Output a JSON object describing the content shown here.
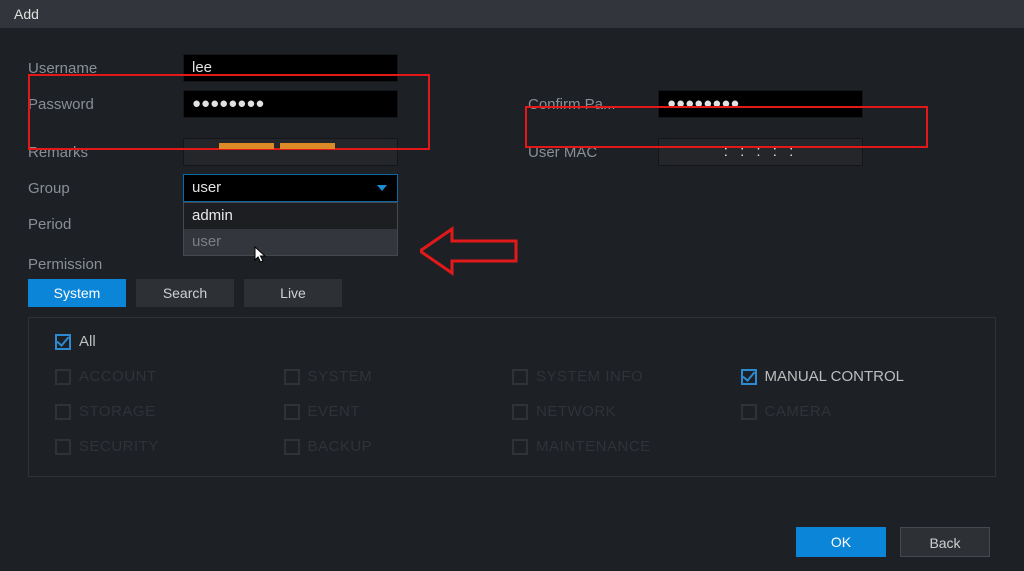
{
  "title": "Add",
  "form": {
    "username_label": "Username",
    "username_value": "lee",
    "password_label": "Password",
    "password_value": "●●●●●●●●",
    "confirm_label": "Confirm Pa...",
    "confirm_value": "●●●●●●●●",
    "remarks_label": "Remarks",
    "remarks_value": "",
    "usermac_label": "User MAC",
    "usermac_value": ":     :     :     :     :",
    "group_label": "Group",
    "group_selected": "user",
    "group_options": {
      "0": "admin",
      "1": "user"
    },
    "period_label": "Period",
    "permission_label": "Permission"
  },
  "tabs": {
    "system": "System",
    "search": "Search",
    "live": "Live"
  },
  "permissions": {
    "all": "All",
    "account": "ACCOUNT",
    "system": "SYSTEM",
    "systeminfo": "SYSTEM INFO",
    "manual": "MANUAL CONTROL",
    "storage": "STORAGE",
    "event": "EVENT",
    "network": "NETWORK",
    "camera": "CAMERA",
    "security": "SECURITY",
    "backup": "BACKUP",
    "maintenance": "MAINTENANCE"
  },
  "buttons": {
    "ok": "OK",
    "back": "Back"
  },
  "colors": {
    "accent": "#0a85d8",
    "highlight": "#e31919",
    "strength": "#dd8b26"
  }
}
